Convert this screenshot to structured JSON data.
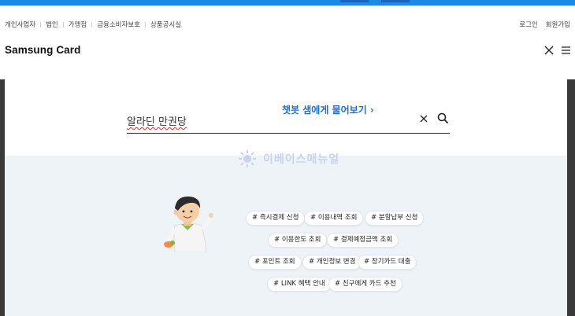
{
  "header": {
    "util_links": [
      "개인사업자",
      "법인",
      "가맹점",
      "금융소비자보호",
      "상품공시실"
    ],
    "login": "로그인",
    "join": "회원가입",
    "logo": "Samsung Card"
  },
  "search": {
    "query": "알라딘 만권당"
  },
  "watermark": "이베이스매뉴얼",
  "chatbot": {
    "title": "챗봇 샘에게 물어보기",
    "chevron": "›",
    "tags": [
      "# 즉시결제 신청",
      "# 이용내역 조회",
      "# 분할납부 신청",
      "# 이용한도 조회",
      "# 결제예정금액 조회",
      "# 포인트 조회",
      "# 개인정보 변경",
      "# 장기카드 대출",
      "# LINK 혜택 안내",
      "# 친구에게 카드 추천"
    ]
  },
  "colors": {
    "accent": "#1a6fd8",
    "top_strip": "#1e88e5",
    "chat_bg": "#eef3f8"
  },
  "icons": [
    "close-icon",
    "menu-icon",
    "search-icon",
    "clear-icon",
    "chevron-right-icon"
  ]
}
